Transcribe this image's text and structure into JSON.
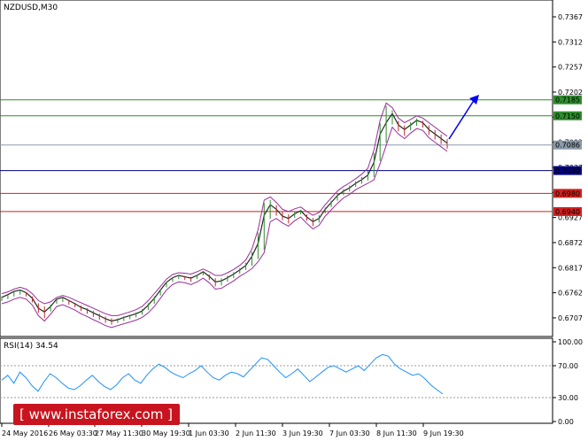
{
  "chart_data": [
    {
      "type": "line",
      "title": "NZDUSD,M30",
      "ylim": [
        0.667,
        0.74
      ],
      "y_ticks": [
        "0.7367",
        "0.7312",
        "0.7257",
        "0.7202",
        "0.7147",
        "0.7092",
        "0.7037",
        "0.6982",
        "0.6927",
        "0.6872",
        "0.6817",
        "0.6762",
        "0.6707"
      ],
      "x_ticks": [
        "24 May 2016",
        "26 May 03:30",
        "27 May 11:30",
        "30 May 19:30",
        "1 Jun 03:30",
        "2 Jun 11:30",
        "3 Jun 19:30",
        "7 Jun 03:30",
        "8 Jun 11:30",
        "9 Jun 19:30"
      ],
      "levels": [
        {
          "label": "0.7185",
          "value": 0.7185,
          "color": "#2e8b2e"
        },
        {
          "label": "0.7150",
          "value": 0.715,
          "color": "#2e8b2e"
        },
        {
          "label": "0.7086",
          "value": 0.7086,
          "color": "#8a9aaa"
        },
        {
          "label": "0.7030",
          "value": 0.703,
          "color": "#00007f"
        },
        {
          "label": "0.6980",
          "value": 0.698,
          "color": "#d02020"
        },
        {
          "label": "0.6940",
          "value": 0.694,
          "color": "#d02020"
        }
      ],
      "series": [
        {
          "color": "#1f2a1f",
          "values": [
            0.6752,
            0.6758,
            0.6765,
            0.6768,
            0.6762,
            0.675,
            0.6728,
            0.672,
            0.6732,
            0.6748,
            0.6752,
            0.6745,
            0.6738,
            0.673,
            0.6725,
            0.6718,
            0.6712,
            0.6705,
            0.67,
            0.6703,
            0.6708,
            0.6712,
            0.6716,
            0.6722,
            0.6735,
            0.675,
            0.6768,
            0.6785,
            0.6795,
            0.68,
            0.6797,
            0.6794,
            0.68,
            0.6808,
            0.6798,
            0.6786,
            0.6788,
            0.6795,
            0.6803,
            0.6812,
            0.6822,
            0.6842,
            0.687,
            0.6932,
            0.6955,
            0.6945,
            0.693,
            0.6925,
            0.6935,
            0.6942,
            0.6928,
            0.6918,
            0.6925,
            0.6945,
            0.696,
            0.6975,
            0.6985,
            0.6992,
            0.7002,
            0.701,
            0.702,
            0.7048,
            0.711,
            0.7135,
            0.7155,
            0.713,
            0.712,
            0.713,
            0.714,
            0.7135,
            0.712,
            0.711,
            0.71,
            0.709
          ]
        },
        {
          "color": "#9a2c9a",
          "values": [
            0.676,
            0.6764,
            0.677,
            0.6774,
            0.677,
            0.676,
            0.6745,
            0.6738,
            0.6742,
            0.6752,
            0.6756,
            0.6752,
            0.6746,
            0.674,
            0.6734,
            0.6728,
            0.6722,
            0.6716,
            0.6712,
            0.6712,
            0.6716,
            0.672,
            0.6725,
            0.6732,
            0.6745,
            0.676,
            0.6776,
            0.6792,
            0.6802,
            0.6806,
            0.6805,
            0.6803,
            0.6808,
            0.6814,
            0.6808,
            0.68,
            0.68,
            0.6806,
            0.6813,
            0.6822,
            0.6834,
            0.6858,
            0.69,
            0.6965,
            0.6972,
            0.696,
            0.6945,
            0.694,
            0.6946,
            0.695,
            0.694,
            0.6932,
            0.6938,
            0.6955,
            0.697,
            0.6985,
            0.6995,
            0.7003,
            0.7012,
            0.7022,
            0.7035,
            0.7075,
            0.714,
            0.7178,
            0.7168,
            0.7145,
            0.7135,
            0.7142,
            0.715,
            0.7145,
            0.7135,
            0.7125,
            0.7115,
            0.7105
          ]
        },
        {
          "color": "#9a2c9a",
          "values": [
            0.6738,
            0.6742,
            0.6748,
            0.6752,
            0.6748,
            0.6735,
            0.6712,
            0.67,
            0.6715,
            0.6732,
            0.6736,
            0.673,
            0.6724,
            0.6716,
            0.671,
            0.6703,
            0.6697,
            0.669,
            0.6686,
            0.669,
            0.6694,
            0.6698,
            0.6702,
            0.6708,
            0.6718,
            0.6732,
            0.675,
            0.6768,
            0.678,
            0.6786,
            0.6784,
            0.678,
            0.6786,
            0.6794,
            0.6784,
            0.677,
            0.6772,
            0.678,
            0.6788,
            0.6798,
            0.6806,
            0.6815,
            0.683,
            0.685,
            0.6918,
            0.6925,
            0.6915,
            0.6908,
            0.692,
            0.6928,
            0.6914,
            0.6902,
            0.691,
            0.693,
            0.6944,
            0.6958,
            0.697,
            0.6978,
            0.6988,
            0.6995,
            0.7002,
            0.701,
            0.7045,
            0.7085,
            0.7125,
            0.711,
            0.71,
            0.7112,
            0.7122,
            0.7118,
            0.7102,
            0.7092,
            0.7082,
            0.7072
          ]
        }
      ],
      "current_price_label": "0.7086",
      "arrow_color": "#0000ee"
    },
    {
      "type": "line",
      "title": "RSI(14) 34.54",
      "ylim": [
        0,
        100
      ],
      "y_ticks": [
        {
          "label": "100.00",
          "value": 100
        },
        {
          "label": "70.00",
          "value": 70
        },
        {
          "label": "30.00",
          "value": 30
        },
        {
          "label": "0.00",
          "value": 0
        }
      ],
      "series": [
        {
          "color": "#1e90ff",
          "values": [
            52,
            58,
            48,
            62,
            55,
            45,
            38,
            50,
            60,
            55,
            48,
            42,
            40,
            45,
            52,
            58,
            50,
            44,
            40,
            46,
            55,
            60,
            52,
            48,
            58,
            66,
            72,
            68,
            62,
            58,
            55,
            60,
            64,
            70,
            62,
            55,
            52,
            58,
            62,
            60,
            56,
            64,
            72,
            80,
            78,
            70,
            62,
            55,
            60,
            66,
            58,
            50,
            56,
            62,
            68,
            70,
            66,
            62,
            66,
            70,
            64,
            72,
            80,
            84,
            82,
            72,
            66,
            62,
            58,
            60,
            54,
            46,
            40,
            34.54
          ]
        }
      ]
    }
  ],
  "watermark": "[ www.instaforex.com ]"
}
